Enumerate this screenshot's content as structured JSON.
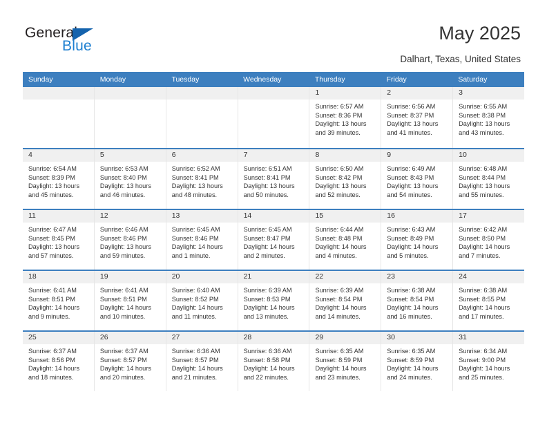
{
  "brand": {
    "name_top": "General",
    "name_bottom": "Blue",
    "accent_color": "#1d7fd0",
    "triangle_color": "#1463ad"
  },
  "header": {
    "title": "May 2025",
    "subtitle": "Dalhart, Texas, United States",
    "header_bar_color": "#3d7fbf",
    "daynum_band_color": "#f0f0f0"
  },
  "weekdays": [
    "Sunday",
    "Monday",
    "Tuesday",
    "Wednesday",
    "Thursday",
    "Friday",
    "Saturday"
  ],
  "weeks": [
    [
      {
        "day": "",
        "sunrise": "",
        "sunset": "",
        "daylight": ""
      },
      {
        "day": "",
        "sunrise": "",
        "sunset": "",
        "daylight": ""
      },
      {
        "day": "",
        "sunrise": "",
        "sunset": "",
        "daylight": ""
      },
      {
        "day": "",
        "sunrise": "",
        "sunset": "",
        "daylight": ""
      },
      {
        "day": "1",
        "sunrise": "Sunrise: 6:57 AM",
        "sunset": "Sunset: 8:36 PM",
        "daylight": "Daylight: 13 hours and 39 minutes."
      },
      {
        "day": "2",
        "sunrise": "Sunrise: 6:56 AM",
        "sunset": "Sunset: 8:37 PM",
        "daylight": "Daylight: 13 hours and 41 minutes."
      },
      {
        "day": "3",
        "sunrise": "Sunrise: 6:55 AM",
        "sunset": "Sunset: 8:38 PM",
        "daylight": "Daylight: 13 hours and 43 minutes."
      }
    ],
    [
      {
        "day": "4",
        "sunrise": "Sunrise: 6:54 AM",
        "sunset": "Sunset: 8:39 PM",
        "daylight": "Daylight: 13 hours and 45 minutes."
      },
      {
        "day": "5",
        "sunrise": "Sunrise: 6:53 AM",
        "sunset": "Sunset: 8:40 PM",
        "daylight": "Daylight: 13 hours and 46 minutes."
      },
      {
        "day": "6",
        "sunrise": "Sunrise: 6:52 AM",
        "sunset": "Sunset: 8:41 PM",
        "daylight": "Daylight: 13 hours and 48 minutes."
      },
      {
        "day": "7",
        "sunrise": "Sunrise: 6:51 AM",
        "sunset": "Sunset: 8:41 PM",
        "daylight": "Daylight: 13 hours and 50 minutes."
      },
      {
        "day": "8",
        "sunrise": "Sunrise: 6:50 AM",
        "sunset": "Sunset: 8:42 PM",
        "daylight": "Daylight: 13 hours and 52 minutes."
      },
      {
        "day": "9",
        "sunrise": "Sunrise: 6:49 AM",
        "sunset": "Sunset: 8:43 PM",
        "daylight": "Daylight: 13 hours and 54 minutes."
      },
      {
        "day": "10",
        "sunrise": "Sunrise: 6:48 AM",
        "sunset": "Sunset: 8:44 PM",
        "daylight": "Daylight: 13 hours and 55 minutes."
      }
    ],
    [
      {
        "day": "11",
        "sunrise": "Sunrise: 6:47 AM",
        "sunset": "Sunset: 8:45 PM",
        "daylight": "Daylight: 13 hours and 57 minutes."
      },
      {
        "day": "12",
        "sunrise": "Sunrise: 6:46 AM",
        "sunset": "Sunset: 8:46 PM",
        "daylight": "Daylight: 13 hours and 59 minutes."
      },
      {
        "day": "13",
        "sunrise": "Sunrise: 6:45 AM",
        "sunset": "Sunset: 8:46 PM",
        "daylight": "Daylight: 14 hours and 1 minute."
      },
      {
        "day": "14",
        "sunrise": "Sunrise: 6:45 AM",
        "sunset": "Sunset: 8:47 PM",
        "daylight": "Daylight: 14 hours and 2 minutes."
      },
      {
        "day": "15",
        "sunrise": "Sunrise: 6:44 AM",
        "sunset": "Sunset: 8:48 PM",
        "daylight": "Daylight: 14 hours and 4 minutes."
      },
      {
        "day": "16",
        "sunrise": "Sunrise: 6:43 AM",
        "sunset": "Sunset: 8:49 PM",
        "daylight": "Daylight: 14 hours and 5 minutes."
      },
      {
        "day": "17",
        "sunrise": "Sunrise: 6:42 AM",
        "sunset": "Sunset: 8:50 PM",
        "daylight": "Daylight: 14 hours and 7 minutes."
      }
    ],
    [
      {
        "day": "18",
        "sunrise": "Sunrise: 6:41 AM",
        "sunset": "Sunset: 8:51 PM",
        "daylight": "Daylight: 14 hours and 9 minutes."
      },
      {
        "day": "19",
        "sunrise": "Sunrise: 6:41 AM",
        "sunset": "Sunset: 8:51 PM",
        "daylight": "Daylight: 14 hours and 10 minutes."
      },
      {
        "day": "20",
        "sunrise": "Sunrise: 6:40 AM",
        "sunset": "Sunset: 8:52 PM",
        "daylight": "Daylight: 14 hours and 11 minutes."
      },
      {
        "day": "21",
        "sunrise": "Sunrise: 6:39 AM",
        "sunset": "Sunset: 8:53 PM",
        "daylight": "Daylight: 14 hours and 13 minutes."
      },
      {
        "day": "22",
        "sunrise": "Sunrise: 6:39 AM",
        "sunset": "Sunset: 8:54 PM",
        "daylight": "Daylight: 14 hours and 14 minutes."
      },
      {
        "day": "23",
        "sunrise": "Sunrise: 6:38 AM",
        "sunset": "Sunset: 8:54 PM",
        "daylight": "Daylight: 14 hours and 16 minutes."
      },
      {
        "day": "24",
        "sunrise": "Sunrise: 6:38 AM",
        "sunset": "Sunset: 8:55 PM",
        "daylight": "Daylight: 14 hours and 17 minutes."
      }
    ],
    [
      {
        "day": "25",
        "sunrise": "Sunrise: 6:37 AM",
        "sunset": "Sunset: 8:56 PM",
        "daylight": "Daylight: 14 hours and 18 minutes."
      },
      {
        "day": "26",
        "sunrise": "Sunrise: 6:37 AM",
        "sunset": "Sunset: 8:57 PM",
        "daylight": "Daylight: 14 hours and 20 minutes."
      },
      {
        "day": "27",
        "sunrise": "Sunrise: 6:36 AM",
        "sunset": "Sunset: 8:57 PM",
        "daylight": "Daylight: 14 hours and 21 minutes."
      },
      {
        "day": "28",
        "sunrise": "Sunrise: 6:36 AM",
        "sunset": "Sunset: 8:58 PM",
        "daylight": "Daylight: 14 hours and 22 minutes."
      },
      {
        "day": "29",
        "sunrise": "Sunrise: 6:35 AM",
        "sunset": "Sunset: 8:59 PM",
        "daylight": "Daylight: 14 hours and 23 minutes."
      },
      {
        "day": "30",
        "sunrise": "Sunrise: 6:35 AM",
        "sunset": "Sunset: 8:59 PM",
        "daylight": "Daylight: 14 hours and 24 minutes."
      },
      {
        "day": "31",
        "sunrise": "Sunrise: 6:34 AM",
        "sunset": "Sunset: 9:00 PM",
        "daylight": "Daylight: 14 hours and 25 minutes."
      }
    ]
  ]
}
